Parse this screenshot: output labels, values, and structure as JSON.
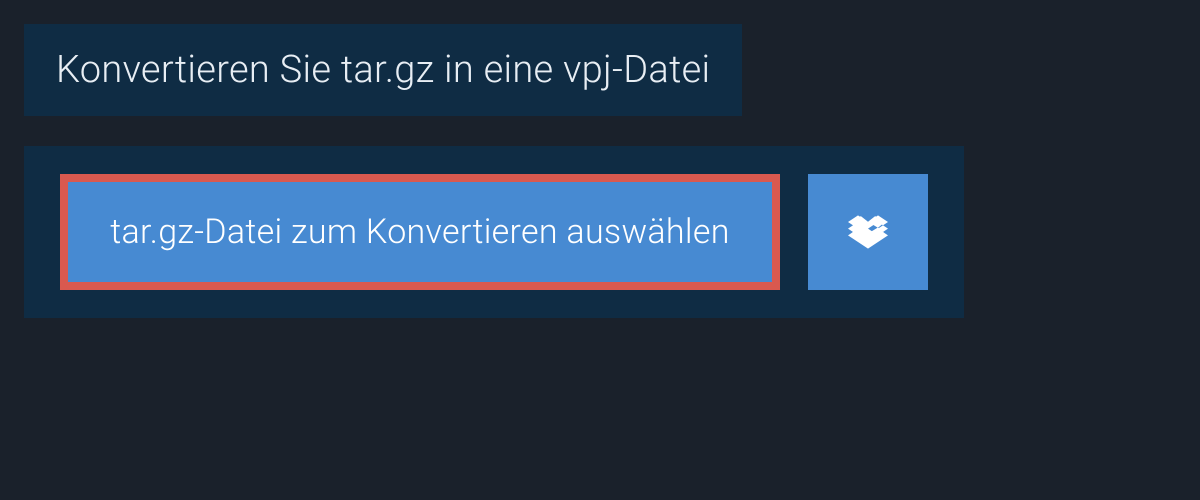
{
  "header": {
    "title": "Konvertieren Sie tar.gz in eine vpj-Datei"
  },
  "upload": {
    "select_label": "tar.gz-Datei zum Konvertieren auswählen"
  }
}
